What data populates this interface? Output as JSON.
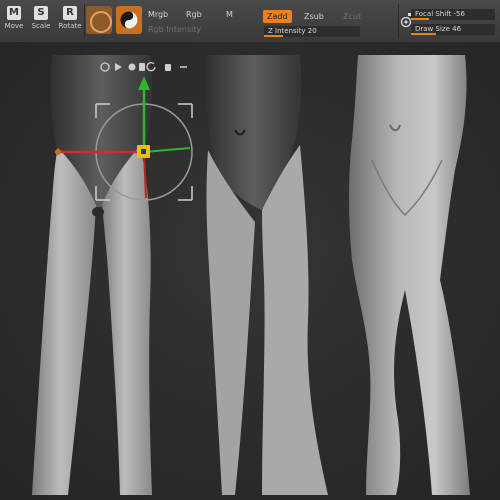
{
  "toolbar": {
    "tools": [
      {
        "label": "Move",
        "icon": "move-icon",
        "glyph": "M"
      },
      {
        "label": "Scale",
        "icon": "scale-icon",
        "glyph": "S"
      },
      {
        "label": "Rotate",
        "icon": "rotate-icon",
        "glyph": "R"
      }
    ],
    "color_modes": {
      "mrgb": "Mrgb",
      "rgb": "Rgb",
      "m": "M",
      "rgb_intensity": "Rgb Intensity"
    },
    "modes": {
      "zadd": "Zadd",
      "zsub": "Zsub",
      "zcut": "Zcut"
    },
    "z_intensity": {
      "label": "Z Intensity",
      "value": 20
    },
    "focal_shift": {
      "label": "Focal Shift",
      "value": -56
    },
    "draw_size": {
      "label": "Draw Size",
      "value": 46
    }
  },
  "colors": {
    "accent": "#e8811e",
    "background": "#2c2c2c",
    "mesh": "#8f8f8f"
  }
}
